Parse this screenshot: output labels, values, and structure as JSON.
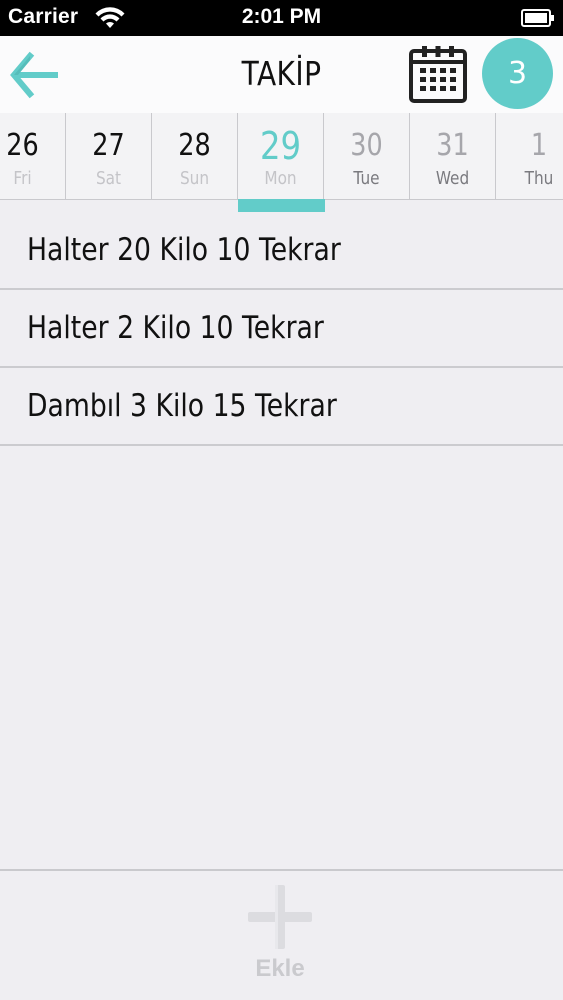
{
  "status_bar": {
    "carrier": "Carrier",
    "time": "2:01 PM",
    "wifi_icon": "wifi-icon",
    "battery_icon": "battery-icon"
  },
  "header": {
    "back_icon": "arrow-left-icon",
    "title": "TAKİP",
    "calendar_icon": "calendar-icon",
    "count_badge": "3"
  },
  "date_strip": {
    "selected_index": 3,
    "dates": [
      {
        "num": "26",
        "day": "Fri"
      },
      {
        "num": "27",
        "day": "Sat"
      },
      {
        "num": "28",
        "day": "Sun"
      },
      {
        "num": "29",
        "day": "Mon"
      },
      {
        "num": "30",
        "day": "Tue"
      },
      {
        "num": "31",
        "day": "Wed"
      },
      {
        "num": "1",
        "day": "Thu"
      }
    ]
  },
  "exercises": [
    "Halter 20 Kilo 10 Tekrar",
    "Halter 2 Kilo 10 Tekrar",
    "Dambıl 3 Kilo 15 Tekrar"
  ],
  "bottom_bar": {
    "add_icon": "plus-icon",
    "add_label": "Ekle"
  },
  "colors": {
    "accent": "#62ccc9",
    "background": "#efeef2"
  }
}
